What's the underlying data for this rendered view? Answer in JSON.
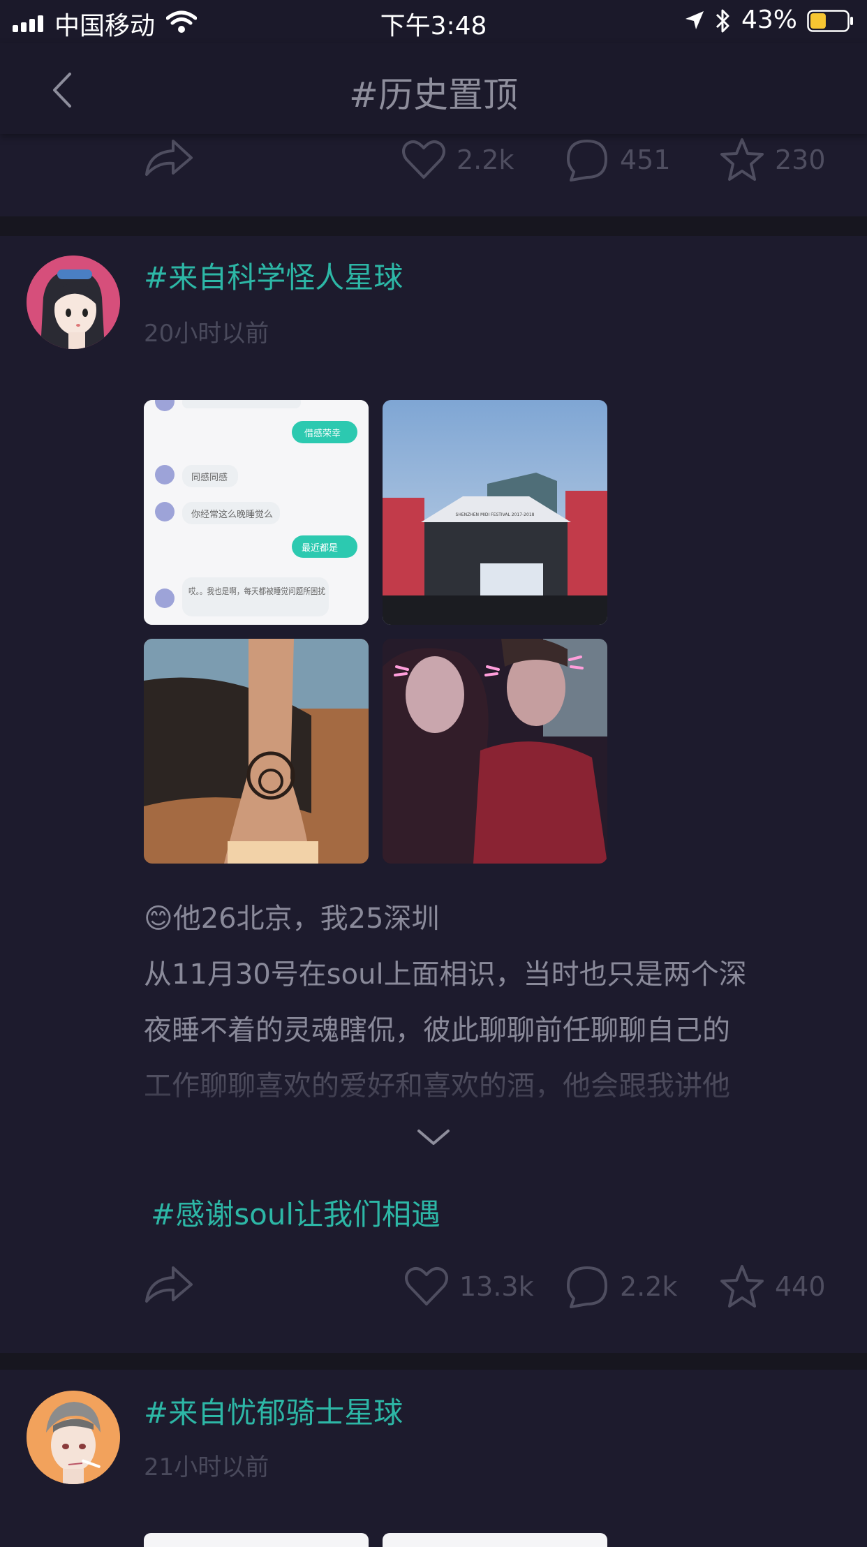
{
  "status_bar": {
    "carrier": "中国移动",
    "time": "下午3:48",
    "battery_percent": "43%",
    "battery_level": 0.43,
    "icons": [
      "signal-icon",
      "wifi-icon",
      "location-icon",
      "bluetooth-icon",
      "battery-icon"
    ]
  },
  "nav": {
    "title": "#历史置顶",
    "back_icon": "chevron-left-icon"
  },
  "previous_post": {
    "likes": "2.2k",
    "comments": "451",
    "favorites": "230"
  },
  "posts": [
    {
      "planet": "#来自科学怪人星球",
      "time_ago": "20小时以前",
      "photos": [
        {
          "kind": "chat-screenshot",
          "messages": [
            {
              "side": "right",
              "text": "借感荣幸"
            },
            {
              "side": "left",
              "text": "同感同感"
            },
            {
              "side": "left",
              "text": "你经常这么晚睡觉么"
            },
            {
              "side": "right",
              "text": "最近都是"
            },
            {
              "side": "left",
              "text": "哎。。我也是啊，每天都被睡觉问题所困扰"
            }
          ]
        },
        {
          "kind": "concert-stage",
          "caption": "SHENZHEN MIDI FESTIVAL 2017-2018"
        },
        {
          "kind": "ankle-tattoo"
        },
        {
          "kind": "couple-selfie"
        }
      ],
      "text_lines": [
        "😊他26北京，我25深圳",
        "从11月30号在soul上面相识，当时也只是两个深",
        "夜睡不着的灵魂瞎侃，彼此聊聊前任聊聊自己的",
        "工作聊聊喜欢的爱好和喜欢的酒，他会跟我讲他"
      ],
      "tag": "#感谢soul让我们相遇",
      "likes": "13.3k",
      "comments": "2.2k",
      "favorites": "440"
    },
    {
      "planet": "#来自忧郁骑士星球",
      "time_ago": "21小时以前"
    }
  ],
  "colors": {
    "background": "#1d1b2d",
    "accent": "#2db7a6",
    "separator": "#17161f",
    "icon": "#4f4e60"
  }
}
